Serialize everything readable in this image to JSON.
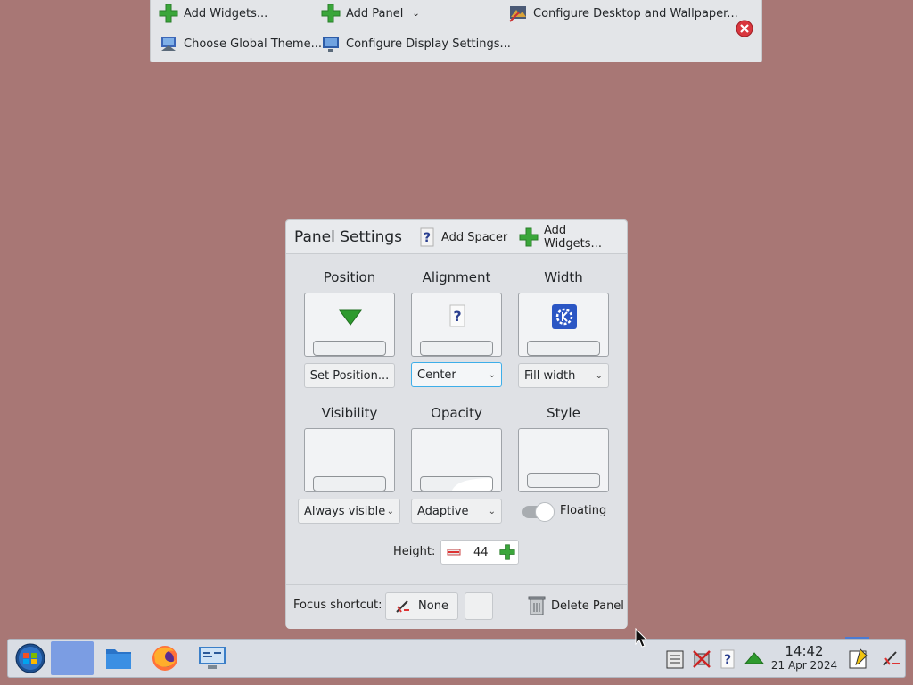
{
  "toolbar": {
    "add_widgets": "Add Widgets...",
    "add_panel": "Add Panel",
    "configure_desktop": "Configure Desktop and Wallpaper...",
    "choose_global_theme": "Choose Global Theme...",
    "configure_display": "Configure Display Settings..."
  },
  "panel_settings": {
    "title": "Panel Settings",
    "add_spacer": "Add Spacer",
    "add_widgets": "Add Widgets...",
    "position": {
      "title": "Position",
      "button": "Set Position..."
    },
    "alignment": {
      "title": "Alignment",
      "value": "Center"
    },
    "width": {
      "title": "Width",
      "value": "Fill width"
    },
    "visibility": {
      "title": "Visibility",
      "value": "Always visible"
    },
    "opacity": {
      "title": "Opacity",
      "value": "Adaptive"
    },
    "style": {
      "title": "Style",
      "toggle_label": "Floating",
      "toggle_on": false
    },
    "height": {
      "label": "Height:",
      "value": "44"
    },
    "focus_shortcut": {
      "label": "Focus shortcut:",
      "value": "None"
    },
    "delete_panel": "Delete Panel"
  },
  "taskbar": {
    "clock_time": "14:42",
    "clock_date": "21 Apr 2024"
  },
  "colors": {
    "desktop": "#a87775",
    "accent": "#3daee9",
    "close_red": "#d9363e",
    "plus_green": "#3aa63a"
  }
}
